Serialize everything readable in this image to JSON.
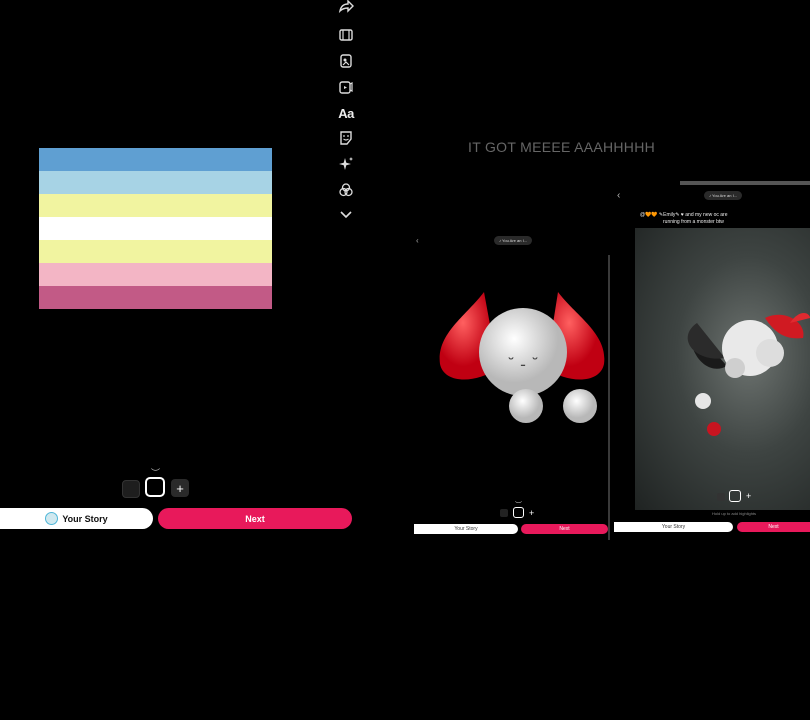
{
  "toolbar": {
    "items": [
      "share-icon",
      "film-icon",
      "sticker-stack-icon",
      "video-card-icon",
      "text-tool",
      "sticker-icon",
      "sparkle-icon",
      "filters-icon",
      "chevron-down-icon"
    ],
    "text_label": "Aa"
  },
  "flag": {
    "stripes": [
      "#5f9fd2",
      "#a7d3e5",
      "#f1f4a0",
      "#ffffff",
      "#f1f4a0",
      "#f3b5c5",
      "#c25a86"
    ]
  },
  "bottom": {
    "your_story": "Your Story",
    "next": "Next",
    "add_symbol": "+"
  },
  "overlay": {
    "caption": "IT GOT MEEEE AAAHHHHH"
  },
  "left_preview": {
    "audio_chip": "♪ You Are an I...",
    "your_story": "Your Story",
    "next": "Next"
  },
  "right_preview": {
    "audio_chip": "♪ You Are an I...",
    "caption_line1": "@🧡🧡 ✎Emily✎ ♥ and my new oc are",
    "caption_line2": "running from a monster btw",
    "hint": "Hold up to add highlights",
    "your_story": "Your Story",
    "next": "Next"
  }
}
